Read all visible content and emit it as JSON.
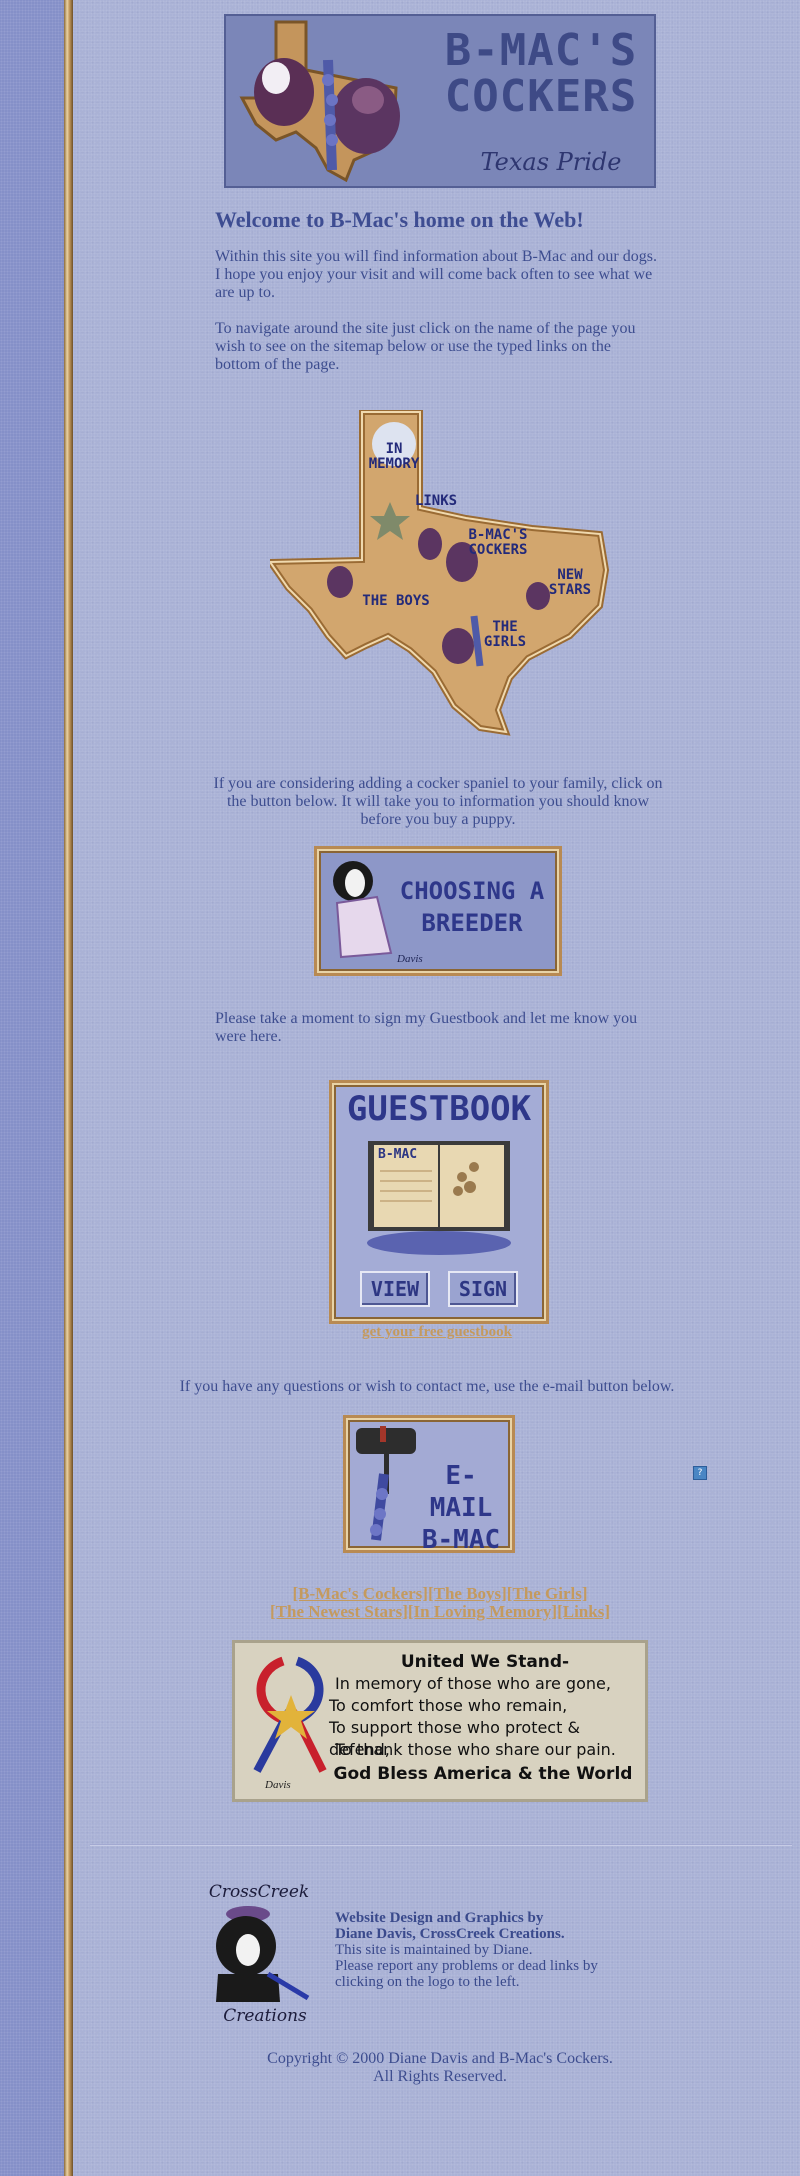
{
  "banner": {
    "title": "B-MAC'S COCKERS",
    "subtitle": "Texas Pride"
  },
  "welcome": {
    "heading": "Welcome to B-Mac's home on the Web!",
    "para1": "Within this site you will find information about B-Mac and our dogs. I hope you enjoy your visit and will come back often to see what we are up to.",
    "para2": "To navigate around the site just click on the name of the page you wish to see on the sitemap below or use the typed links on the bottom of the page."
  },
  "sitemap": {
    "in_memory": "IN MEMORY",
    "links": "LINKS",
    "bmacs_cockers": "B-MAC'S COCKERS",
    "new_stars": "NEW STARS",
    "the_boys": "THE BOYS",
    "the_girls": "THE GIRLS"
  },
  "puppy": {
    "text": "If you are considering adding a cocker spaniel to your family, click on the button below. It will take you to information you should know before you buy a puppy.",
    "button_label": "CHOOSING A BREEDER",
    "signature": "Davis"
  },
  "guestbook": {
    "text": "Please take a moment to sign my Guestbook and let me know you were here.",
    "title": "GUESTBOOK",
    "book_label": "B-MAC",
    "view_label": "VIEW",
    "sign_label": "SIGN",
    "free_link": "get your free guestbook"
  },
  "contact": {
    "text": "If you have any questions or wish to contact me, use the e-mail button below.",
    "email_label": "E-MAIL B-MAC",
    "help_icon_label": "?"
  },
  "nav_links": {
    "row1": "[B-Mac's Cockers][The Boys][The Girls]",
    "row2": "[The Newest Stars][In Loving Memory][Links]"
  },
  "memorial": {
    "title": "United We Stand-",
    "line1": "In memory of those who are gone,",
    "line2": "To comfort those who remain,",
    "line3": "To support those who protect & defend,",
    "line4": "To thank those who share our pain.",
    "closing": "God Bless America & the World",
    "signature": "Davis"
  },
  "footer": {
    "logo_top": "CrossCreek",
    "logo_bottom": "Creations",
    "credit_bold1": "Website Design and Graphics by",
    "credit_bold2": "Diane Davis, CrossCreek Creations.",
    "maintained": "This site is maintained by Diane.",
    "report": "Please report any problems or dead links by clicking on the logo to the left.",
    "copyright1": "Copyright © 2000 Diane Davis and B-Mac's Cockers.",
    "copyright2": "All Rights Reserved."
  },
  "colors": {
    "page_bg": "#aab2d6",
    "text": "#3d4d8f",
    "link": "#c49a5e",
    "frame": "#b88a52"
  }
}
